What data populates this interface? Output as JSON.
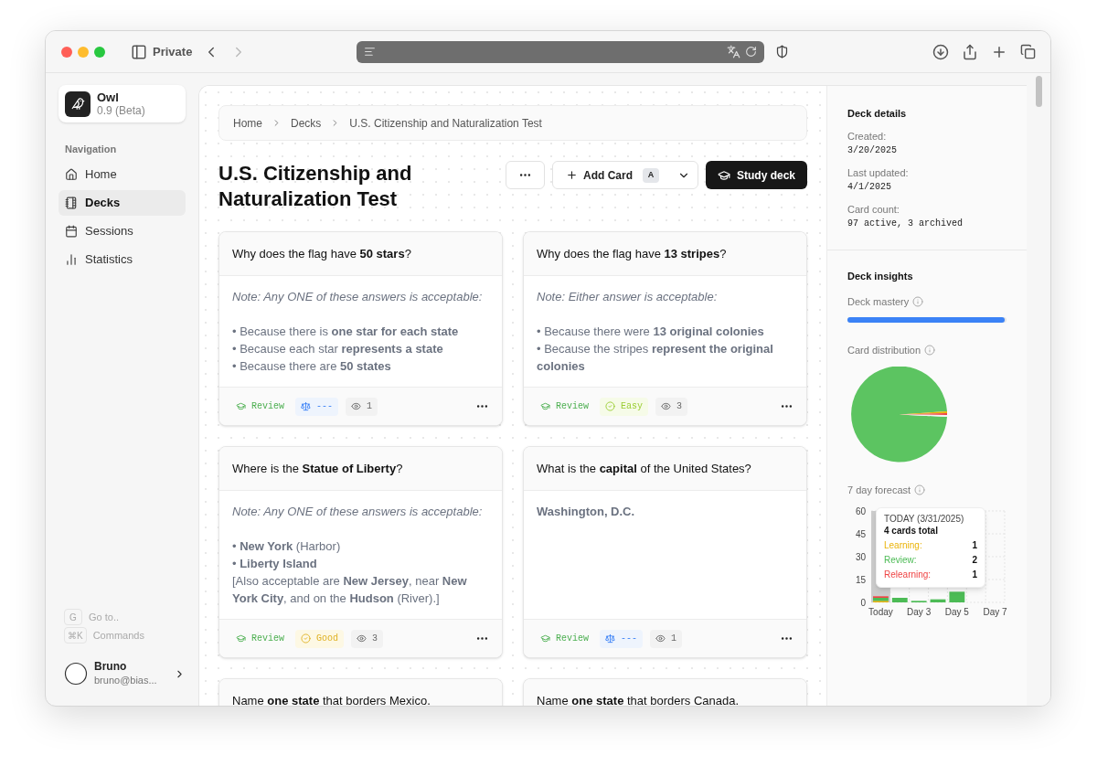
{
  "browser": {
    "private_label": "Private"
  },
  "app": {
    "name": "Owl",
    "version": "0.9 (Beta)"
  },
  "sidebar": {
    "section_label": "Navigation",
    "items": [
      {
        "label": "Home",
        "selected": false
      },
      {
        "label": "Decks",
        "selected": true
      },
      {
        "label": "Sessions",
        "selected": false
      },
      {
        "label": "Statistics",
        "selected": false
      }
    ],
    "shortcuts": [
      {
        "key": "G",
        "label": "Go to.."
      },
      {
        "key": "⌘K",
        "label": "Commands"
      }
    ],
    "user": {
      "name": "Bruno",
      "email": "bruno@bias..."
    }
  },
  "breadcrumb": [
    "Home",
    "Decks",
    "U.S. Citizenship and Naturalization Test"
  ],
  "title": "U.S. Citizenship and Naturalization Test",
  "actions": {
    "add_card": {
      "label": "Add Card",
      "shortcut": "A"
    },
    "study": "Study deck"
  },
  "cards": [
    {
      "question": "Why does the flag have **50 stars**?",
      "note": "Note: Any ONE of these answers is acceptable:",
      "lines": [
        "• Because there is **one star for each state**",
        "• Because each star **represents a state**",
        "• Because there are **50 states**"
      ],
      "status": "Review",
      "rating": {
        "kind": "none",
        "label": "---"
      },
      "views": "1"
    },
    {
      "question": "Why does the flag have **13 stripes**?",
      "note": "Note: Either answer is acceptable:",
      "lines": [
        "• Because there were **13 original colonies**",
        "• Because the stripes **represent the original colonies**"
      ],
      "status": "Review",
      "rating": {
        "kind": "easy",
        "label": "Easy"
      },
      "views": "3"
    },
    {
      "question": "Where is the **Statue of Liberty**?",
      "note": "Note: Any ONE of these answers is acceptable:",
      "lines": [
        "• **New York** (Harbor)",
        "• **Liberty Island**",
        "[Also acceptable are **New Jersey**, near **New York City**, and on the **Hudson** (River).]"
      ],
      "status": "Review",
      "rating": {
        "kind": "good",
        "label": "Good"
      },
      "views": "3"
    },
    {
      "question": "What is the **capital** of the United States?",
      "lines": [
        "**Washington, D.C.**"
      ],
      "status": "Review",
      "rating": {
        "kind": "none",
        "label": "---"
      },
      "views": "1"
    },
    {
      "question": "Name **one state** that borders Mexico."
    },
    {
      "question": "Name **one state** that borders Canada."
    }
  ],
  "details": {
    "title": "Deck details",
    "fields": [
      {
        "label": "Created:",
        "value": "3/20/2025"
      },
      {
        "label": "Last updated:",
        "value": "4/1/2025"
      },
      {
        "label": "Card count:",
        "value": "97 active, 3 archived"
      }
    ]
  },
  "insights": {
    "title": "Deck insights",
    "mastery": {
      "label": "Deck mastery",
      "level": 0.99
    },
    "distribution": {
      "label": "Card distribution"
    },
    "forecast": {
      "label": "7 day forecast",
      "chart_data": {
        "type": "bar",
        "stacked": true,
        "grid": true,
        "categories": [
          "Today",
          null,
          "Day 3",
          null,
          "Day 5",
          null,
          "Day 7"
        ],
        "ylim": [
          0,
          60
        ],
        "yticks": [
          0,
          15,
          30,
          45,
          60
        ],
        "series": [
          {
            "color": "#eab308",
            "values": [
              1,
              0,
              0,
              0,
              0,
              0,
              0
            ]
          },
          {
            "color": "#4cbb55",
            "values": [
              2,
              3,
              1,
              2,
              7,
              0,
              0
            ]
          },
          {
            "color": "#ef4444",
            "values": [
              1,
              0,
              0,
              0,
              0,
              0,
              0
            ]
          }
        ]
      },
      "tooltip": {
        "title": "TODAY (3/31/2025)",
        "total": "4 cards total",
        "rows": [
          {
            "label": "Learning:",
            "value": "1"
          },
          {
            "label": "Review:",
            "value": "2"
          },
          {
            "label": "Relearning:",
            "value": "1"
          }
        ]
      }
    }
  }
}
